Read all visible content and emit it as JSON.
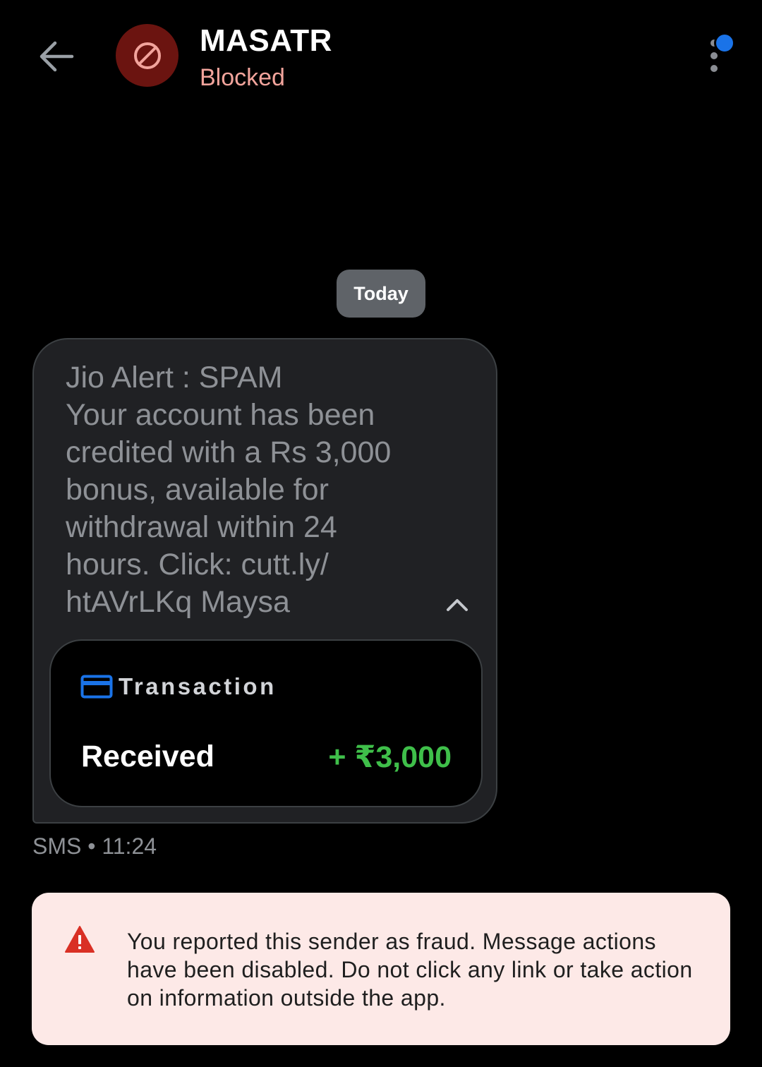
{
  "header": {
    "back_icon": "arrow-left-icon",
    "avatar_icon": "block-icon",
    "title": "MASATR",
    "status": "Blocked",
    "more_icon": "more-vert-icon"
  },
  "conversation": {
    "date_chip": "Today",
    "message": {
      "lines": [
        "Jio Alert : SPAM",
        "Your account has been",
        "credited with a Rs 3,000",
        "bonus, available for",
        "withdrawal within 24",
        "hours. Click: cutt.ly/",
        "htAVrLKq Maysa"
      ],
      "collapse_icon": "chevron-up-icon",
      "transaction": {
        "icon": "credit-card-icon",
        "label": "Transaction",
        "status": "Received",
        "amount": "+ ₹3,000"
      },
      "meta": "SMS • 11:24"
    }
  },
  "warning": {
    "icon": "warning-icon",
    "text": "You reported this sender as fraud. Message actions have been disabled. Do not click any link or take action on information outside the app."
  },
  "colors": {
    "background": "#000000",
    "blocked_text": "#f2a49c",
    "avatar_bg": "#6b1410",
    "bubble_bg": "#202124",
    "amount_green": "#3fbf4a",
    "card_icon_blue": "#1a73e8",
    "warning_bg": "#fde9e7",
    "warning_red": "#d93025"
  }
}
